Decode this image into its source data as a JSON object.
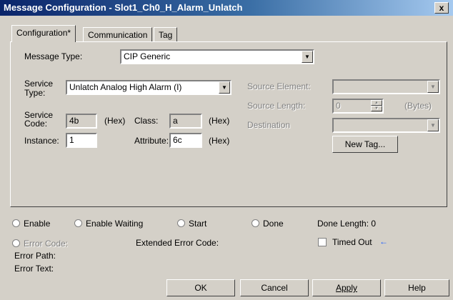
{
  "window": {
    "title": "Message Configuration - Slot1_Ch0_H_Alarm_Unlatch",
    "close_glyph": "x"
  },
  "tabs": [
    {
      "label": "Configuration*",
      "active": true
    },
    {
      "label": "Communication",
      "active": false
    },
    {
      "label": "Tag",
      "active": false
    }
  ],
  "config": {
    "message_type_label": "Message Type:",
    "message_type_value": "CIP Generic",
    "service_type_label_1": "Service",
    "service_type_label_2": "Type:",
    "service_type_value": "Unlatch Analog High Alarm (I)",
    "service_code_label_1": "Service",
    "service_code_label_2": "Code:",
    "service_code_value": "4b",
    "hex_1": "(Hex)",
    "class_label": "Class:",
    "class_value": "a",
    "hex_2": "(Hex)",
    "instance_label": "Instance:",
    "instance_value": "1",
    "attribute_label": "Attribute:",
    "attribute_value": "6c",
    "hex_3": "(Hex)",
    "source_element_label": "Source Element:",
    "source_element_value": "",
    "source_length_label": "Source Length:",
    "source_length_value": "0",
    "bytes_label": "(Bytes)",
    "destination_label": "Destination",
    "destination_value": "",
    "new_tag_button": "New Tag..."
  },
  "status": {
    "enable": "Enable",
    "enable_waiting": "Enable Waiting",
    "start": "Start",
    "done": "Done",
    "done_length": "Done Length: 0",
    "error_code": "Error Code:",
    "extended_error_code": "Extended Error Code:",
    "timed_out": "Timed Out",
    "timed_out_arrow": "←",
    "error_path": "Error Path:",
    "error_text": "Error Text:"
  },
  "buttons": {
    "ok": "OK",
    "cancel": "Cancel",
    "apply": "Apply",
    "help": "Help"
  },
  "colors": {
    "title_start": "#0a246a",
    "title_end": "#a6caf0",
    "face": "#d4d0c8",
    "arrow": "#1a5cff"
  }
}
